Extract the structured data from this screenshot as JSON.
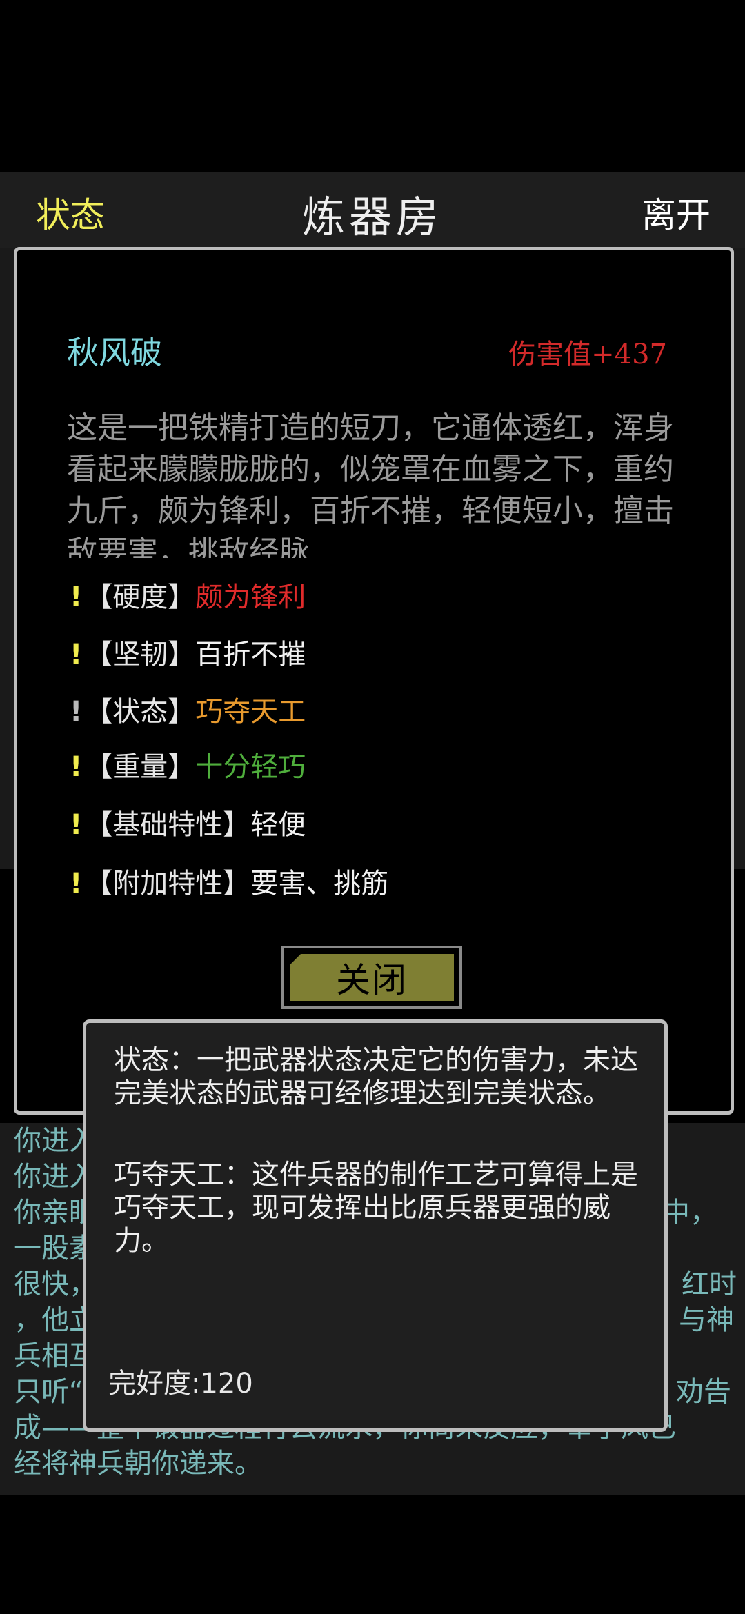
{
  "header": {
    "status_label": "状态",
    "title": "炼器房",
    "leave_label": "离开"
  },
  "item": {
    "name": "秋风破",
    "damage": "伤害值+437",
    "description": "这是一把铁精打造的短刀，它通体透红，浑身看起来朦朦胧胧的，似笼罩在血雾之下，重约九斤，颇为锋利，百折不摧，轻便短小，擅击敌要害，挑敌经脉",
    "attributes": [
      {
        "bang": "!",
        "label": "【硬度】",
        "value": "颇为锋利"
      },
      {
        "bang": "!",
        "label": "【坚韧】",
        "value": "百折不摧"
      },
      {
        "bang": "!",
        "label": "【状态】",
        "value": "巧夺天工"
      },
      {
        "bang": "!",
        "label": "【重量】",
        "value": "十分轻巧"
      },
      {
        "bang": "!",
        "label": "【基础特性】",
        "value": "轻便"
      },
      {
        "bang": "!",
        "label": "【附加特性】",
        "value": "要害、挑筋"
      }
    ],
    "close_label": "关闭"
  },
  "tooltip": {
    "text1": "状态：一把武器状态决定它的伤害力，未达完美状态的武器可经修理达到完美状态。",
    "text2": "巧夺天工：这件兵器的制作工艺可算得上是巧夺天工，现可发挥出比原兵器更强的威力。",
    "durability": "完好度:120"
  },
  "log": {
    "lines": [
      "你进入",
      "你进入",
      "你亲眼",
      "一股素",
      "很快，",
      "，他立",
      "兵相互",
      "只听“",
      "成——整个锻器过程行云流水，你尚未反应，宰于风已",
      "经将神兵朝你递来。"
    ],
    "right_fragments": [
      "中，",
      "红时",
      "与神",
      "劝告"
    ]
  },
  "colors": {
    "header_status": "#f1ee5a",
    "item_name": "#7fd8e0",
    "damage": "#d22a2a",
    "log_text": "#79b9b9",
    "button": "#7f7f33"
  }
}
